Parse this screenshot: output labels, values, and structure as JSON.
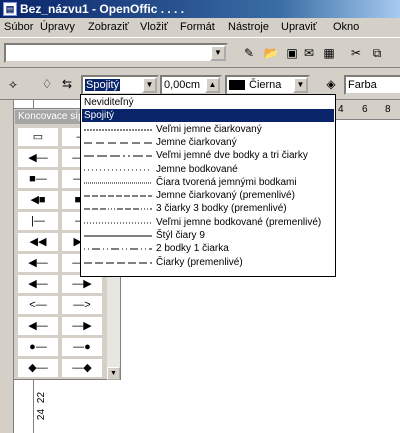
{
  "window": {
    "title": "Bez_názvu1 - OpenOffic . . . ."
  },
  "menu": [
    {
      "label": "Súbor"
    },
    {
      "label": "Úpravy"
    },
    {
      "label": "Zobraziť"
    },
    {
      "label": "Vložiť"
    },
    {
      "label": "Formát"
    },
    {
      "label": "Nástroje"
    },
    {
      "label": "Upraviť"
    },
    {
      "label": "Okno"
    }
  ],
  "toolbar": {
    "line_style_value": "Spojitý",
    "width_value": "0,00cm",
    "color_value": "Čierna",
    "fill_value": "Farba"
  },
  "ruler_h": [
    "4",
    "6",
    "8"
  ],
  "ruler_v": [
    "22",
    "24"
  ],
  "arrow_panel": {
    "title": "Koncovace síp"
  },
  "line_styles": [
    {
      "label": "Neviditeľný",
      "dash": "none"
    },
    {
      "label": "Spojitý",
      "dash": "solid",
      "selected": true
    },
    {
      "label": "Veľmi jemne čiarkovaný",
      "dash": "2,1"
    },
    {
      "label": "Jemne čiarkovaný",
      "dash": "8,4"
    },
    {
      "label": "Veľmi jemné dve bodky a tri čiarky",
      "dash": "10,3,10,3,10,3,2,3,2,3"
    },
    {
      "label": "Jemne bodkované",
      "dash": "1,3"
    },
    {
      "label": "Čiara tvorená jemnými bodkami",
      "dash": "1,1"
    },
    {
      "label": "Jemne čiarkovaný (premenlivé)",
      "dash": "6,2"
    },
    {
      "label": "3 čiarky 3 bodky (premenlivé)",
      "dash": "6,2,6,2,6,2,1,2,1,2,1,2"
    },
    {
      "label": "Veľmi jemne bodkované (premenlivé)",
      "dash": "1,2"
    },
    {
      "label": "Štýl čiary 9",
      "dash": "solid"
    },
    {
      "label": "2 bodky 1 čiarka",
      "dash": "1,3,1,3,8,3"
    },
    {
      "label": "Čiarky (premenlivé)",
      "dash": "8,3"
    }
  ]
}
